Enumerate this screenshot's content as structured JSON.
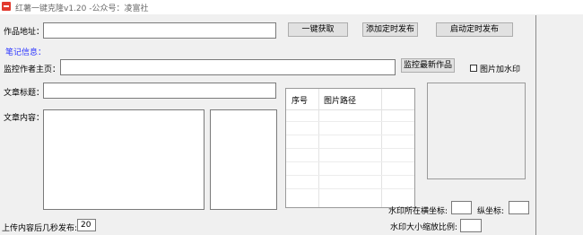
{
  "window": {
    "title": "红薯一键克隆v1.20 -公众号：凌富社",
    "app_icon_color": "#e23a2f"
  },
  "form": {
    "work_url_label": "作品地址：",
    "work_url_value": "",
    "fetch_button": "一键获取",
    "add_schedule_button": "添加定时发布",
    "start_schedule_button": "启动定时发布",
    "notes_section": "笔记信息：",
    "monitor_author_label": "监控作者主页：",
    "monitor_author_value": "",
    "monitor_latest_button": "监控最新作品",
    "watermark_checkbox_label": "图片加水印",
    "watermark_checked": false,
    "article_title_label": "文章标题：",
    "article_title_value": "",
    "article_content_label": "文章内容：",
    "article_content_value": "",
    "publish_delay_label": "上传内容后几秒发布:",
    "publish_delay_value": "20",
    "watermark_x_label": "水印所在横坐标:",
    "watermark_x_value": "",
    "watermark_y_label": "纵坐标:",
    "watermark_y_value": "",
    "watermark_scale_label": "水印大小缩放比例:",
    "watermark_scale_value": ""
  },
  "image_list": {
    "columns": [
      "序号",
      "图片路径"
    ],
    "rows": []
  },
  "colors": {
    "section_text": "#2b35ff",
    "background": "#f0f0f0"
  }
}
